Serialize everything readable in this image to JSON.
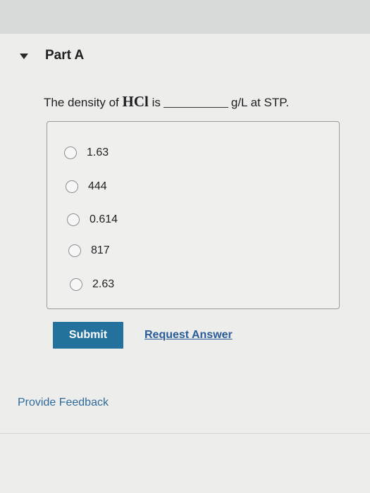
{
  "part": {
    "title": "Part A"
  },
  "question": {
    "prefix": "The density of ",
    "chemical": "HCl",
    "mid": " is",
    "suffix": "g/L at STP."
  },
  "choices": [
    {
      "label": "1.63",
      "selected": false
    },
    {
      "label": "444",
      "selected": false
    },
    {
      "label": "0.614",
      "selected": false
    },
    {
      "label": "817",
      "selected": false
    },
    {
      "label": "2.63",
      "selected": false
    }
  ],
  "actions": {
    "submit_label": "Submit",
    "request_label": "Request Answer"
  },
  "feedback": {
    "label": "Provide Feedback"
  },
  "colors": {
    "submit_bg": "#24719d",
    "link": "#2a5c98"
  }
}
